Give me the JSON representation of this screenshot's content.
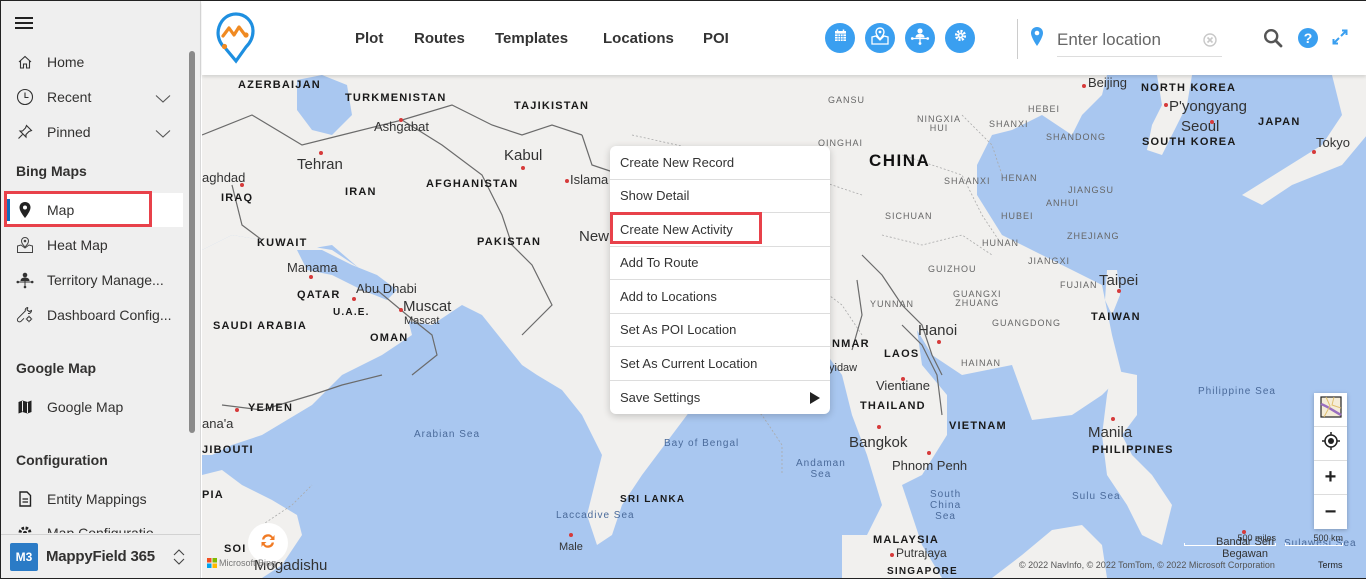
{
  "sidebar": {
    "items_top": [
      {
        "label": "Home",
        "icon": "home-icon"
      },
      {
        "label": "Recent",
        "icon": "clock-icon",
        "expandable": true
      },
      {
        "label": "Pinned",
        "icon": "pin-icon",
        "expandable": true
      }
    ],
    "sections": [
      {
        "title": "Bing Maps",
        "items": [
          {
            "label": "Map",
            "icon": "map-pin-icon",
            "active": true
          },
          {
            "label": "Heat Map",
            "icon": "heat-map-icon"
          },
          {
            "label": "Territory Manage...",
            "icon": "territory-icon"
          },
          {
            "label": "Dashboard Config...",
            "icon": "wrench-gear-icon"
          }
        ]
      },
      {
        "title": "Google Map",
        "items": [
          {
            "label": "Google Map",
            "icon": "folded-map-icon"
          }
        ]
      },
      {
        "title": "Configuration",
        "items": [
          {
            "label": "Entity Mappings",
            "icon": "document-icon"
          },
          {
            "label": "Map Configuratio",
            "icon": "gear-icon"
          }
        ]
      }
    ],
    "footer": {
      "badge": "M3",
      "app_name": "MappyField 365"
    }
  },
  "header": {
    "nav": [
      "Plot",
      "Routes",
      "Templates",
      "Locations",
      "POI"
    ],
    "action_buttons": [
      "calendar-icon",
      "map-location-icon",
      "hierarchy-icon",
      "settings-icon"
    ],
    "location_placeholder": "Enter location",
    "accent_color": "#3a9ff0"
  },
  "context_menu": {
    "items": [
      "Create New Record",
      "Show Detail",
      "Create New Activity",
      "Add To Route",
      "Add to Locations",
      "Set As POI Location",
      "Set As Current Location",
      "Save Settings"
    ],
    "highlighted": "Create New Activity"
  },
  "map": {
    "countries": [
      "AZERBAIJAN",
      "TURKMENISTAN",
      "TAJIKISTAN",
      "IRAN",
      "AFGHANISTAN",
      "IRAQ",
      "PAKISTAN",
      "KUWAIT",
      "QATAR",
      "U.A.E.",
      "SAUDI ARABIA",
      "OMAN",
      "YEMEN",
      "DJIBOUTI",
      "SRI LANKA",
      "CHINA",
      "NORTH KOREA",
      "SOUTH KOREA",
      "JAPAN",
      "TAIWAN",
      "LAOS",
      "THAILAND",
      "VIETNAM",
      "PHILIPPINES",
      "MALAYSIA",
      "SINGAPORE",
      "MYANMAR",
      "SOMALIA",
      "ETHIOPIA"
    ],
    "cities": [
      "Ashgabat",
      "Tehran",
      "Kabul",
      "Islamabad",
      "Baghdad",
      "Manama",
      "Abu Dhabi",
      "Muscat",
      "Mascat",
      "Sana'a",
      "New Delhi",
      "Beijing",
      "P'yongyang",
      "Seoul",
      "Tokyo",
      "Taipei",
      "Hanoi",
      "Vientiane",
      "Bangkok",
      "Phnom Penh",
      "Manila",
      "Putrajaya",
      "Bandar Seri Begawan",
      "Male",
      "Mogadishu",
      "Naypyidaw"
    ],
    "provinces": [
      "GANSU",
      "QINGHAI",
      "NINGXIA HUI",
      "SHANXI",
      "HEBEI",
      "SHANDONG",
      "SHAANXI",
      "HENAN",
      "JIANGSU",
      "ANHUI",
      "SICHUAN",
      "HUBEI",
      "HUNAN",
      "ZHEJIANG",
      "GUIZHOU",
      "JIANGXI",
      "FUJIAN",
      "YUNNAN",
      "GUANGXI ZHUANG",
      "GUANGDONG",
      "HAINAN"
    ],
    "seas": [
      "Arabian Sea",
      "Bay of Bengal",
      "Laccadive Sea",
      "Andaman Sea",
      "South China Sea",
      "Philippine Sea",
      "Sulu Sea",
      "Sulawesi Sea"
    ],
    "scale_miles": "500 miles",
    "scale_km": "500 km",
    "copyright": "© 2022 NavInfo, © 2022 TomTom, © 2022 Microsoft Corporation",
    "terms": "Terms",
    "attribution": "Microsoft Bing"
  }
}
